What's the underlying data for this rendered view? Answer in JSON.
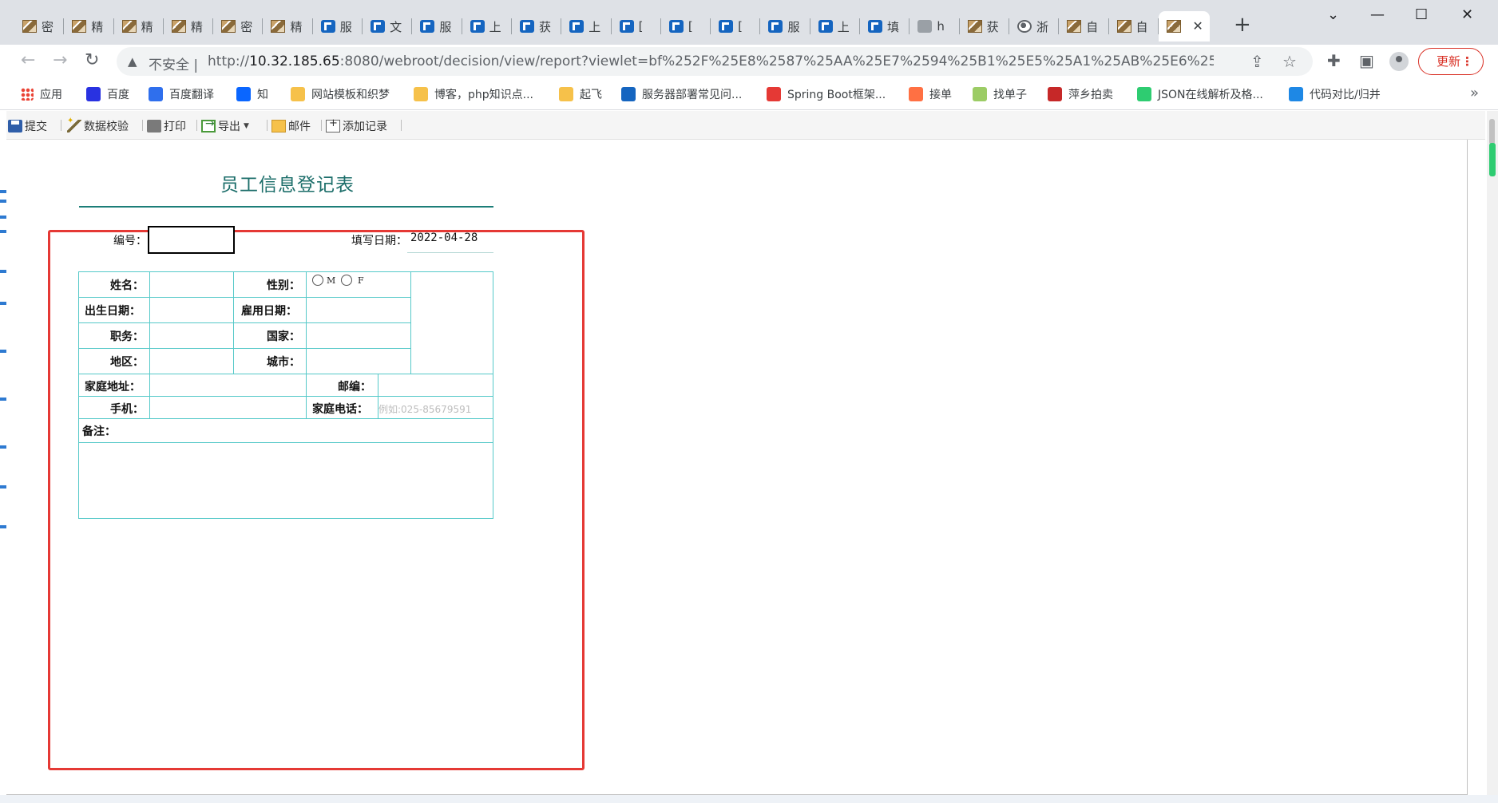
{
  "browser": {
    "tabs": [
      {
        "icon": "image-icon",
        "title": "密"
      },
      {
        "icon": "image-icon",
        "title": "精"
      },
      {
        "icon": "image-icon",
        "title": "精"
      },
      {
        "icon": "image-icon",
        "title": "精"
      },
      {
        "icon": "image-icon",
        "title": "密"
      },
      {
        "icon": "image-icon",
        "title": "精"
      },
      {
        "icon": "finereport-icon",
        "title": "服"
      },
      {
        "icon": "finereport-icon",
        "title": "文"
      },
      {
        "icon": "finereport-icon",
        "title": "服"
      },
      {
        "icon": "finereport-icon",
        "title": "上"
      },
      {
        "icon": "finereport-icon",
        "title": "获"
      },
      {
        "icon": "finereport-icon",
        "title": "上"
      },
      {
        "icon": "finereport-icon",
        "title": "["
      },
      {
        "icon": "finereport-icon",
        "title": "["
      },
      {
        "icon": "finereport-icon",
        "title": "["
      },
      {
        "icon": "finereport-icon",
        "title": "服"
      },
      {
        "icon": "finereport-icon",
        "title": "上"
      },
      {
        "icon": "finereport-icon",
        "title": "填"
      },
      {
        "icon": "gray-icon",
        "title": "h"
      },
      {
        "icon": "image-icon",
        "title": "获"
      },
      {
        "icon": "globe-icon",
        "title": "浙"
      },
      {
        "icon": "image-icon",
        "title": "自"
      },
      {
        "icon": "image-icon",
        "title": "自"
      }
    ],
    "active_tab": {
      "icon": "image-icon",
      "close": "✕"
    },
    "new_tab": "+",
    "window_controls": {
      "minimize": "—",
      "maximize": "☐",
      "close": "✕",
      "tab_search": "⌄"
    },
    "nav": {
      "back": "←",
      "forward": "→",
      "reload": "↻"
    },
    "address": {
      "security_icon": "▲",
      "security_label": "不安全",
      "separator": "|",
      "url_scheme": "http://",
      "url_host": "10.32.185.65",
      "url_rest": ":8080/webroot/decision/view/report?viewlet=bf%252F%25E8%2587%25AA%25E7%2594%25B1%25E5%25A1%25AB%25E6%258A%2..."
    },
    "toolbar_icons": {
      "share": "⇪",
      "star": "☆",
      "extensions": "✚",
      "sidepanel": "▣"
    },
    "update_button": "更新",
    "update_menu": "⋮",
    "bookmarks": [
      {
        "label": "应用",
        "icon": "apps-icon",
        "color": "#ea4335"
      },
      {
        "label": "百度",
        "icon": "baidu-icon",
        "color": "#2932e1"
      },
      {
        "label": "百度翻译",
        "icon": "translate-icon",
        "color": "#2f6fed"
      },
      {
        "label": "知",
        "icon": "zhihu-icon",
        "color": "#0a66ff"
      },
      {
        "label": "网站模板和织梦",
        "icon": "folder-icon",
        "color": "#f6c14a"
      },
      {
        "label": "博客，php知识点...",
        "icon": "folder-icon",
        "color": "#f6c14a"
      },
      {
        "label": "起飞",
        "icon": "folder-icon",
        "color": "#f6c14a"
      },
      {
        "label": "服务器部署常见问...",
        "icon": "finereport-icon",
        "color": "#1565c0"
      },
      {
        "label": "Spring Boot框架...",
        "icon": "csdn-icon",
        "color": "#e53935"
      },
      {
        "label": "接单",
        "icon": "orange-icon",
        "color": "#ff7043"
      },
      {
        "label": "找单子",
        "icon": "grid-icon",
        "color": "#9ccc65"
      },
      {
        "label": "萍乡拍卖",
        "icon": "auction-icon",
        "color": "#c62828"
      },
      {
        "label": "JSON在线解析及格...",
        "icon": "json-icon",
        "color": "#2ecc71"
      },
      {
        "label": "代码对比/归并",
        "icon": "compare-icon",
        "color": "#1e88e5"
      }
    ],
    "bookmarks_more": "»"
  },
  "report_toolbar": {
    "submit": "提交",
    "validate": "数据校验",
    "print": "打印",
    "export": "导出",
    "export_caret": "▼",
    "mail": "邮件",
    "add_record": "添加记录"
  },
  "form": {
    "title": "员工信息登记表",
    "code_label": "编号：",
    "fill_date_label": "填写日期：",
    "fill_date": "2022-04-28",
    "labels": {
      "name": "姓名：",
      "gender": "性别：",
      "birth_date": "出生日期：",
      "hire_date": "雇用日期：",
      "position": "职务：",
      "country": "国家：",
      "region": "地区：",
      "city": "城市：",
      "home_address": "家庭地址：",
      "postcode": "邮编：",
      "mobile": "手机：",
      "home_phone": "家庭电话：",
      "remarks": "备注："
    },
    "gender_options": [
      "M",
      "F"
    ],
    "home_phone_placeholder": "例如:025-85679591"
  },
  "colors": {
    "form_title": "#1c6e6a",
    "grid_line": "#55c9c9",
    "highlight": "#e53935",
    "update": "#d93025"
  }
}
